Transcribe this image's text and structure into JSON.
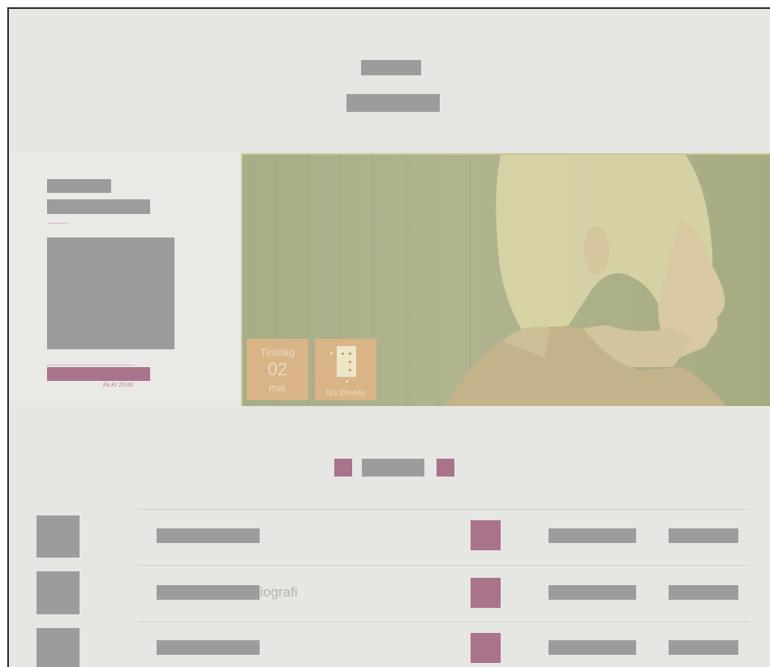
{
  "hero": {
    "date_tile": {
      "weekday": "Tirsdag",
      "day": "02",
      "month": "mai"
    },
    "venue_tile": {
      "label": "NS Direkte"
    },
    "ticket_price": "fra Kr 20.00"
  },
  "list": {
    "rows": [
      {
        "title_fragment": ""
      },
      {
        "title_fragment": "biografi"
      },
      {
        "title_fragment": ""
      }
    ]
  },
  "colors": {
    "page_background": "#e6e6e2",
    "accent_pink": "#a8738b",
    "hero_tint": "#a6ad87",
    "tile_orange": "#d9b486",
    "redaction_gray": "#9c9c9c"
  }
}
